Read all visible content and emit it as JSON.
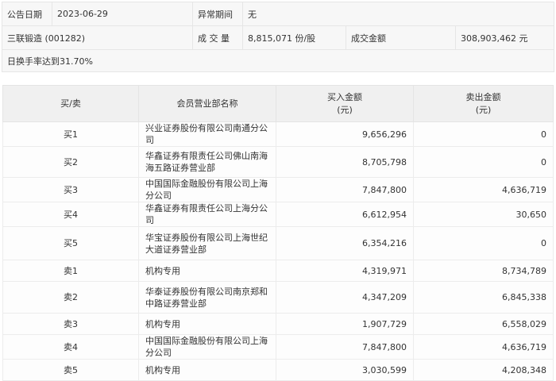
{
  "info": {
    "date_label": "公告日期",
    "date_value": "2023-06-29",
    "period_label": "异常期间",
    "period_value": "无",
    "stock": "三联锻造 (001282)",
    "volume_label": "成 交 量",
    "volume_value": "8,815,071 份/股",
    "amount_label": "成交金额",
    "amount_value": "308,903,462 元",
    "reason": "日换手率达到31.70%"
  },
  "table": {
    "headers": {
      "side": "买/卖",
      "name": "会员营业部名称",
      "buy": "买入金额",
      "buy_unit": "(元)",
      "sell": "卖出金额",
      "sell_unit": "(元)"
    },
    "rows": [
      {
        "side": "买1",
        "name": "兴业证券股份有限公司南通分公司",
        "buy": "9,656,296",
        "sell": "0"
      },
      {
        "side": "买2",
        "name": "华鑫证券有限责任公司佛山南海海五路证券营业部",
        "buy": "8,705,798",
        "sell": "0"
      },
      {
        "side": "买3",
        "name": "中国国际金融股份有限公司上海分公司",
        "buy": "7,847,800",
        "sell": "4,636,719"
      },
      {
        "side": "买4",
        "name": "华鑫证券有限责任公司上海分公司",
        "buy": "6,612,954",
        "sell": "30,650"
      },
      {
        "side": "买5",
        "name": "华宝证券股份有限公司上海世纪大道证券营业部",
        "buy": "6,354,216",
        "sell": "0"
      },
      {
        "side": "卖1",
        "name": "机构专用",
        "buy": "4,319,971",
        "sell": "8,734,789"
      },
      {
        "side": "卖2",
        "name": "华泰证券股份有限公司南京郑和中路证券营业部",
        "buy": "4,347,209",
        "sell": "6,845,338"
      },
      {
        "side": "卖3",
        "name": "机构专用",
        "buy": "1,907,729",
        "sell": "6,558,029"
      },
      {
        "side": "卖4",
        "name": "中国国际金融股份有限公司上海分公司",
        "buy": "7,847,800",
        "sell": "4,636,719"
      },
      {
        "side": "卖5",
        "name": "机构专用",
        "buy": "3,030,599",
        "sell": "4,208,348"
      }
    ]
  }
}
